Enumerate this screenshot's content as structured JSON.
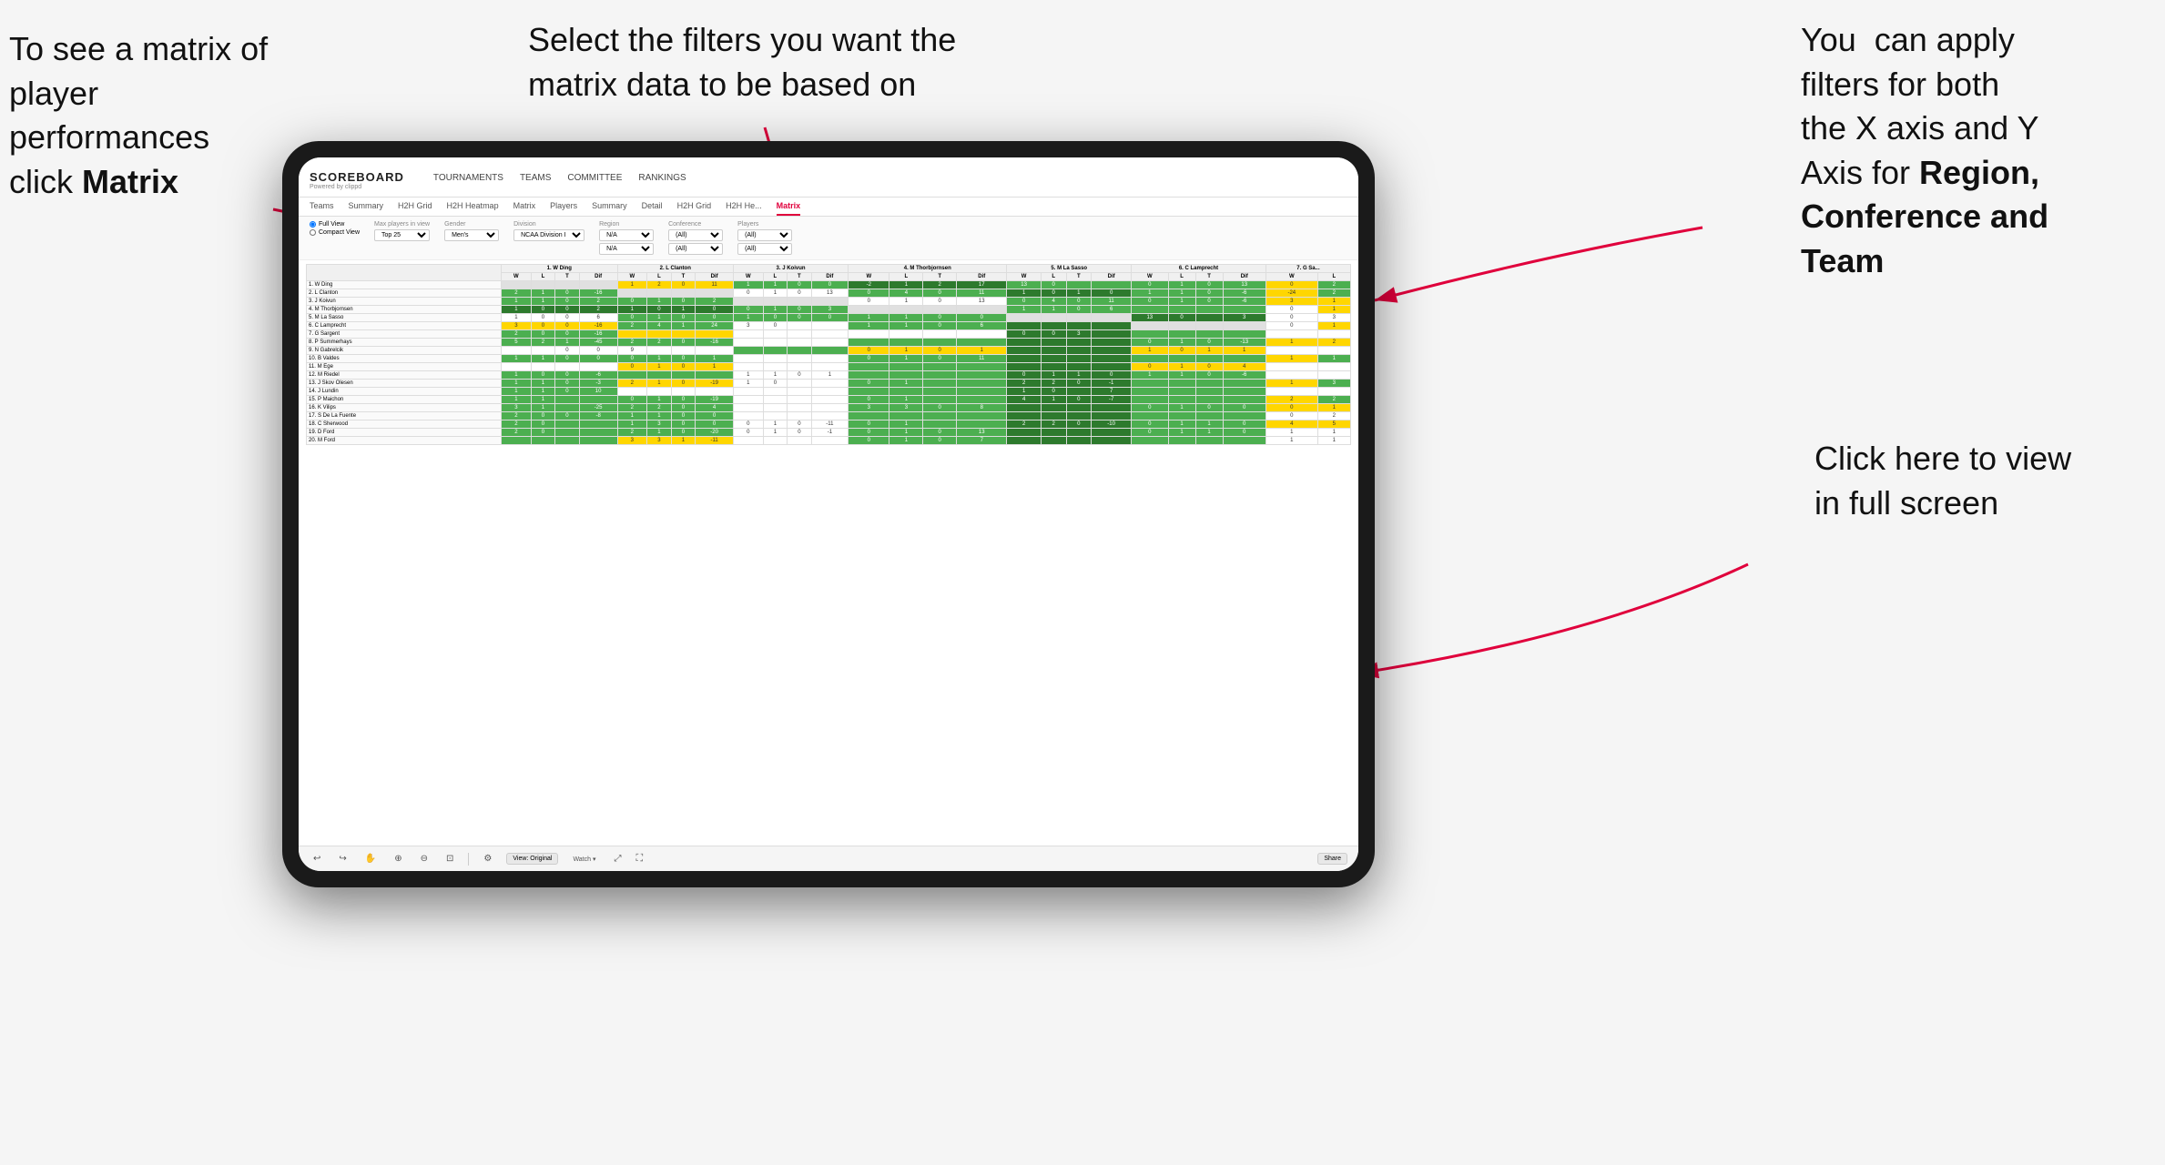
{
  "annotations": {
    "left": {
      "line1": "To see a matrix of",
      "line2": "player performances",
      "line3_plain": "click ",
      "line3_bold": "Matrix"
    },
    "middle": {
      "text": "Select the filters you want the matrix data to be based on"
    },
    "right": {
      "line1": "You  can apply",
      "line2": "filters for both",
      "line3": "the X axis and Y",
      "line4_plain": "Axis for ",
      "line4_bold": "Region,",
      "line5_bold": "Conference and",
      "line6_bold": "Team"
    },
    "bottom_right": {
      "line1": "Click here to view",
      "line2": "in full screen"
    }
  },
  "nav": {
    "logo_main": "SCOREBOARD",
    "logo_sub": "Powered by clippd",
    "links": [
      "TOURNAMENTS",
      "TEAMS",
      "COMMITTEE",
      "RANKINGS"
    ]
  },
  "sub_tabs": [
    "Teams",
    "Summary",
    "H2H Grid",
    "H2H Heatmap",
    "Matrix",
    "Players",
    "Summary",
    "Detail",
    "H2H Grid",
    "H2H He...",
    "Matrix"
  ],
  "filters": {
    "view_options": [
      "Full View",
      "Compact View"
    ],
    "max_players_label": "Max players in view",
    "max_players_value": "Top 25",
    "gender_label": "Gender",
    "gender_value": "Men's",
    "division_label": "Division",
    "division_value": "NCAA Division I",
    "region_label": "Region",
    "region_value1": "N/A",
    "region_value2": "N/A",
    "conference_label": "Conference",
    "conference_value1": "(All)",
    "conference_value2": "(All)",
    "players_label": "Players",
    "players_value1": "(All)",
    "players_value2": "(All)"
  },
  "col_headers": [
    {
      "num": "1.",
      "name": "W Ding"
    },
    {
      "num": "2.",
      "name": "L Clanton"
    },
    {
      "num": "3.",
      "name": "J Koivun"
    },
    {
      "num": "4.",
      "name": "M Thorbjornsen"
    },
    {
      "num": "5.",
      "name": "M La Sasso"
    },
    {
      "num": "6.",
      "name": "C Lamprecht"
    },
    {
      "num": "7.",
      "name": "G Sa..."
    }
  ],
  "sub_col_headers": [
    "W",
    "L",
    "T",
    "Dif"
  ],
  "rows": [
    {
      "num": "1.",
      "name": "W Ding"
    },
    {
      "num": "2.",
      "name": "L Clanton"
    },
    {
      "num": "3.",
      "name": "J Koivun"
    },
    {
      "num": "4.",
      "name": "M Thorbjornsen"
    },
    {
      "num": "5.",
      "name": "M La Sasso"
    },
    {
      "num": "6.",
      "name": "C Lamprecht"
    },
    {
      "num": "7.",
      "name": "G Sargent"
    },
    {
      "num": "8.",
      "name": "P Summerhays"
    },
    {
      "num": "9.",
      "name": "N Gabrelcik"
    },
    {
      "num": "10.",
      "name": "B Valdes"
    },
    {
      "num": "11.",
      "name": "M Ege"
    },
    {
      "num": "12.",
      "name": "M Riedel"
    },
    {
      "num": "13.",
      "name": "J Skov Olesen"
    },
    {
      "num": "14.",
      "name": "J Lundin"
    },
    {
      "num": "15.",
      "name": "P Maichon"
    },
    {
      "num": "16.",
      "name": "K Vilips"
    },
    {
      "num": "17.",
      "name": "S De La Fuente"
    },
    {
      "num": "18.",
      "name": "C Sherwood"
    },
    {
      "num": "19.",
      "name": "D Ford"
    },
    {
      "num": "20.",
      "name": "M Ford"
    }
  ],
  "toolbar": {
    "view_label": "View: Original",
    "watch_label": "Watch ▾",
    "share_label": "Share"
  }
}
